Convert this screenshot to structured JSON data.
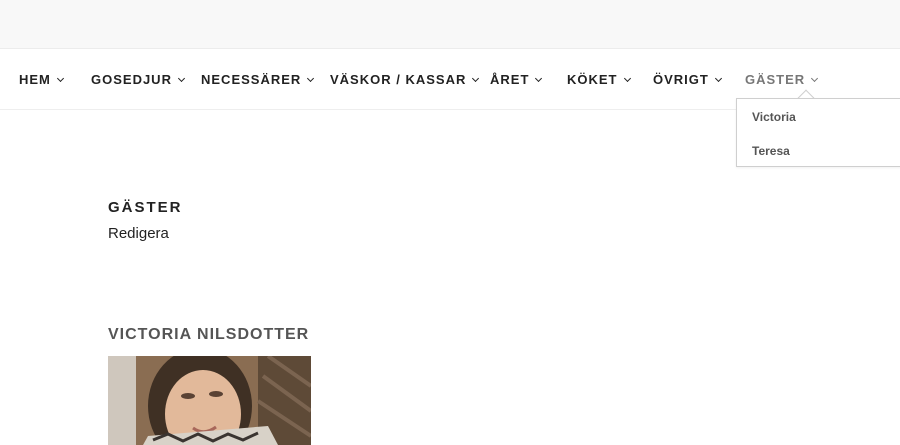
{
  "nav": {
    "items": [
      {
        "label": "HEM"
      },
      {
        "label": "GOSEDJUR"
      },
      {
        "label": "NECESSÄRER"
      },
      {
        "label": "VÄSKOR / KASSAR"
      },
      {
        "label": "ÅRET"
      },
      {
        "label": "KÖKET"
      },
      {
        "label": "ÖVRIGT"
      },
      {
        "label": "GÄSTER"
      }
    ],
    "dropdown": [
      "Victoria",
      "Teresa"
    ]
  },
  "page": {
    "title": "GÄSTER",
    "edit_label": "Redigera",
    "guest_name": "VICTORIA NILSDOTTER"
  },
  "colors": {
    "accent": "#222222",
    "active_nav": "#777777",
    "guest_heading": "#555555"
  }
}
